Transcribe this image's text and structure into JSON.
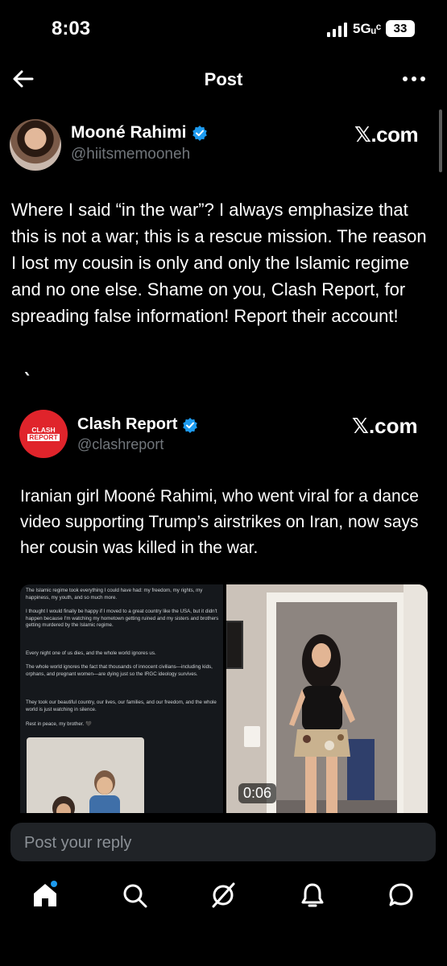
{
  "status_bar": {
    "time": "8:03",
    "network": "5Gᵤᶜ",
    "battery": "33"
  },
  "nav": {
    "title": "Post",
    "back_icon": "arrow-left-icon",
    "more_icon": "more-horizontal-icon"
  },
  "post": {
    "author_name": "Mooné Rahimi",
    "author_handle": "@hiitsmemooneh",
    "source_label": "𝕏.com",
    "text": "Where I said “in the war”? I always emphasize that this is not a war; this is a rescue mission. The reason I lost my cousin is only and only the Islamic regime and no one else. Shame on you, Clash Report, for spreading false information! Report their account!"
  },
  "quoted": {
    "author_name": "Clash Report",
    "author_handle": "@clashreport",
    "source_label": "𝕏.com",
    "avatar_text": [
      "CLASH",
      "REPORT"
    ],
    "text": "Iranian girl Mooné Rahimi, who went viral for a dance video supporting Trump’s airstrikes on Iran, now says her cousin was killed in the war.",
    "media": {
      "doc_paragraphs": [
        "The Islamic regime took everything I could have had: my freedom, my rights, my happiness, my youth, and so much more.",
        "I thought I would finally be happy if I moved to a great country like the USA, but it didn't happen because I'm watching my hometown getting ruined and my sisters and brothers getting murdered by the Islamic regime.",
        "Every night one of us dies, and the whole world ignores us.",
        "The whole world ignores the fact that thousands of innocent civilians—including kids, orphans, and pregnant women—are dying just so the IRGC ideology survives.",
        "They took our beautiful country, our lives, our families, and our freedom, and the whole world is just watching in silence.",
        "Rest in peace, my brother. 🖤"
      ],
      "video_duration": "0:06"
    }
  },
  "reply": {
    "placeholder": "Post your reply"
  },
  "tabs": [
    "home-icon",
    "search-icon",
    "grok-icon",
    "notifications-icon",
    "messages-icon"
  ],
  "colors": {
    "accent": "#1d9bf0",
    "background": "#000000",
    "secondary_text": "#71767b"
  }
}
